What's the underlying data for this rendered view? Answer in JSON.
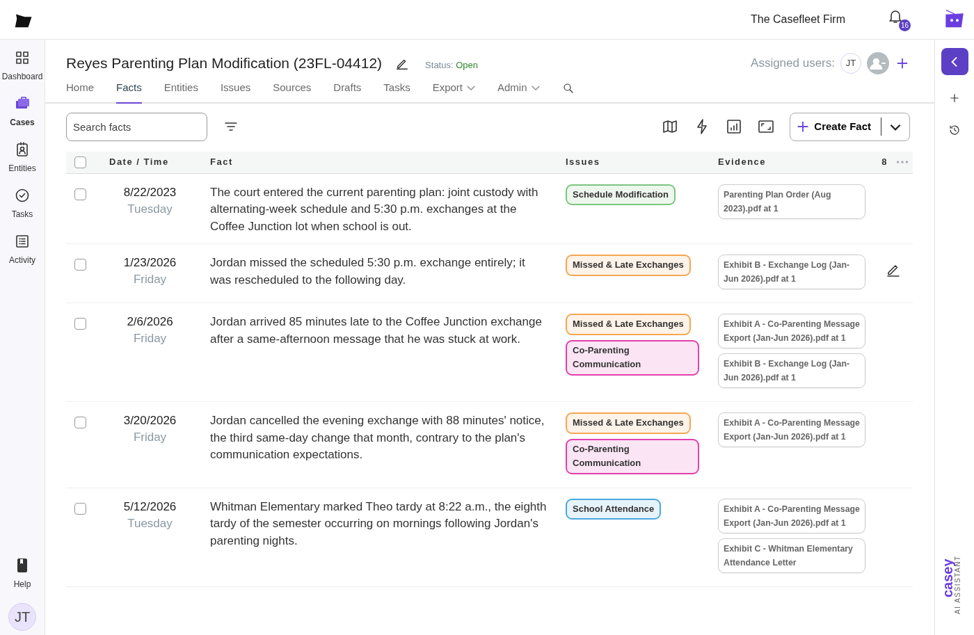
{
  "header": {
    "firm": "The Casefleet Firm",
    "notifications": "16"
  },
  "sidebar": {
    "items": [
      {
        "label": "Dashboard",
        "selected": false
      },
      {
        "label": "Cases",
        "selected": true
      },
      {
        "label": "Entities",
        "selected": false
      },
      {
        "label": "Tasks",
        "selected": false
      },
      {
        "label": "Activity",
        "selected": false
      }
    ],
    "help": "Help",
    "user_initials": "JT"
  },
  "case": {
    "title": "Reyes Parenting Plan Modification (23FL-04412)",
    "status_label": "Status:",
    "status": "Open",
    "assigned_label": "Assigned users:",
    "assigned_initials": "JT"
  },
  "tabs": [
    {
      "label": "Home",
      "selected": false,
      "dropdown": false
    },
    {
      "label": "Facts",
      "selected": true,
      "dropdown": false
    },
    {
      "label": "Entities",
      "selected": false,
      "dropdown": false
    },
    {
      "label": "Issues",
      "selected": false,
      "dropdown": false
    },
    {
      "label": "Sources",
      "selected": false,
      "dropdown": false
    },
    {
      "label": "Drafts",
      "selected": false,
      "dropdown": false
    },
    {
      "label": "Tasks",
      "selected": false,
      "dropdown": false
    },
    {
      "label": "Export",
      "selected": false,
      "dropdown": true
    },
    {
      "label": "Admin",
      "selected": false,
      "dropdown": true
    }
  ],
  "toolbar": {
    "search": {
      "placeholder": "Search facts"
    },
    "create_button": "Create Fact"
  },
  "table": {
    "select_all_checked": false,
    "columns": [
      "Date / Time",
      "Fact",
      "Issues",
      "Evidence"
    ],
    "count": "8",
    "rows": [
      {
        "checked": false,
        "hovered": false,
        "date": "8/22/2023",
        "weekday": "Tuesday",
        "fact": "The court entered the current parenting plan: joint custody with alternating-week schedule and 5:30 p.m. exchanges at the Coffee Junction lot when school is out.",
        "issues": [
          {
            "label": "Schedule Modification",
            "color": "#7cc47f"
          }
        ],
        "evidence": [
          "Parenting Plan Order (Aug 2023).pdf at 1"
        ]
      },
      {
        "checked": false,
        "hovered": true,
        "date": "1/23/2026",
        "weekday": "Friday",
        "fact": "Jordan missed the scheduled 5:30 p.m. exchange entirely; it was rescheduled to the following day.",
        "issues": [
          {
            "label": "Missed & Late Exchanges",
            "color": "#f5a653"
          }
        ],
        "evidence": [
          "Exhibit B - Exchange Log (Jan-Jun 2026).pdf at 1"
        ]
      },
      {
        "checked": false,
        "hovered": false,
        "date": "2/6/2026",
        "weekday": "Friday",
        "fact": "Jordan arrived 85 minutes late to the Coffee Junction exchange after a same-afternoon message that he was stuck at work.",
        "issues": [
          {
            "label": "Missed & Late Exchanges",
            "color": "#f5a653"
          },
          {
            "label": "Co-Parenting Communication",
            "color": "#e23fae"
          }
        ],
        "evidence": [
          "Exhibit A - Co-Parenting Message Export (Jan-Jun 2026).pdf at 1",
          "Exhibit B - Exchange Log (Jan-Jun 2026).pdf at 1"
        ]
      },
      {
        "checked": false,
        "hovered": false,
        "date": "3/20/2026",
        "weekday": "Friday",
        "fact": "Jordan cancelled the evening exchange with 88 minutes' notice, the third same-day change that month, contrary to the plan's communication expectations.",
        "issues": [
          {
            "label": "Missed & Late Exchanges",
            "color": "#f5a653"
          },
          {
            "label": "Co-Parenting Communication",
            "color": "#e23fae"
          }
        ],
        "evidence": [
          "Exhibit A - Co-Parenting Message Export (Jan-Jun 2026).pdf at 1"
        ]
      },
      {
        "checked": false,
        "hovered": false,
        "date": "5/12/2026",
        "weekday": "Tuesday",
        "fact": "Whitman Elementary marked Theo tardy at 8:22 a.m., the eighth tardy of the semester occurring on mornings following Jordan's parenting nights.",
        "issues": [
          {
            "label": "School Attendance",
            "color": "#4aa8e0"
          }
        ],
        "evidence": [
          "Exhibit A - Co-Parenting Message Export (Jan-Jun 2026).pdf at 1",
          "Exhibit C - Whitman Elementary Attendance Letter"
        ]
      }
    ]
  },
  "assistant": {
    "name": "casey",
    "subtitle": "AI ASSISTANT"
  }
}
